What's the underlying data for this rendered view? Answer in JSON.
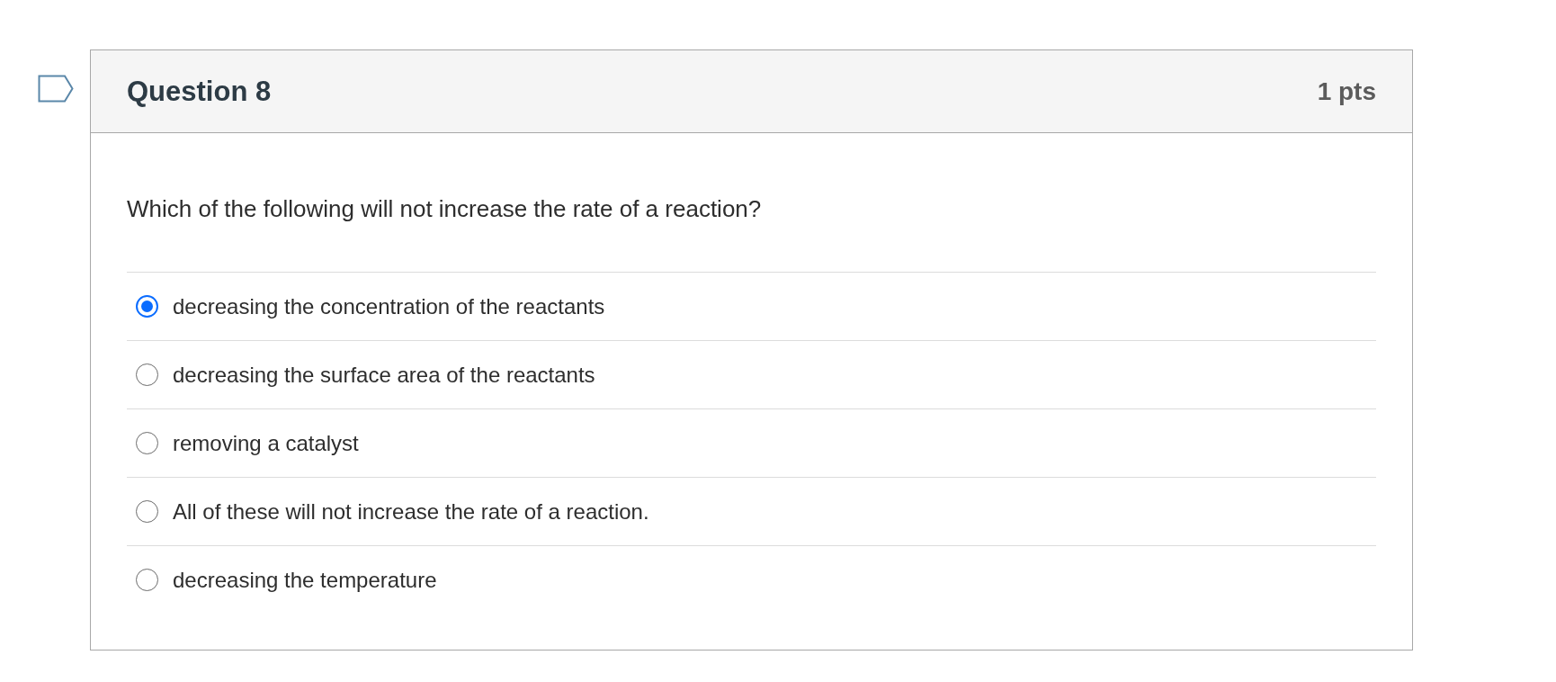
{
  "question": {
    "title": "Question 8",
    "points": "1 pts",
    "text": "Which of the following will not increase the rate of a reaction?",
    "answers": [
      {
        "label": "decreasing the concentration of the reactants",
        "selected": true
      },
      {
        "label": "decreasing the surface area of the reactants",
        "selected": false
      },
      {
        "label": "removing a catalyst",
        "selected": false
      },
      {
        "label": "All of these will not increase the rate of a reaction.",
        "selected": false
      },
      {
        "label": "decreasing the temperature",
        "selected": false
      }
    ]
  }
}
